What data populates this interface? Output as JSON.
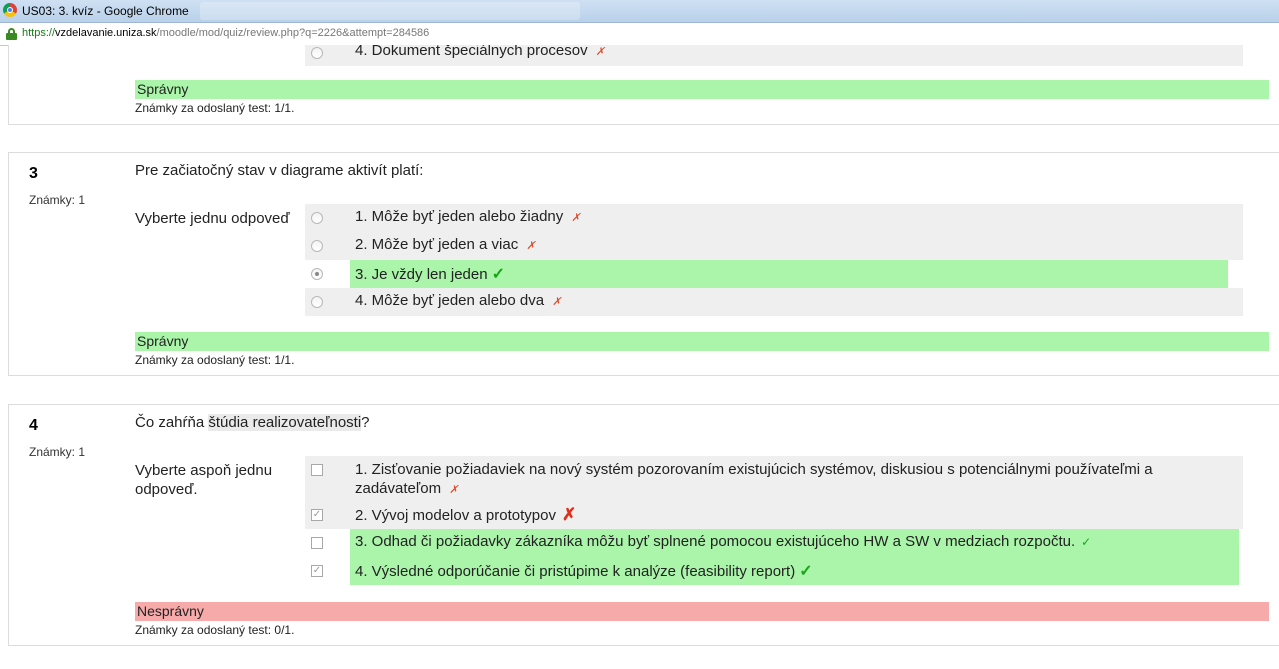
{
  "window": {
    "title": "US03: 3. kvíz - Google Chrome"
  },
  "address": {
    "scheme": "https://",
    "host": "vzdelavanie.uniza.sk",
    "path": "/moodle/mod/quiz/review.php?q=2226&attempt=284586"
  },
  "q2_partial": {
    "answer4": "4. Dokument špeciálnych procesov",
    "state": "Správny",
    "mark": "Známky za odoslaný test: 1/1."
  },
  "q3": {
    "number": "3",
    "grade": "Známky: 1",
    "text": "Pre začiatočný stav v diagrame aktivít platí:",
    "prompt": "Vyberte jednu odpoveď",
    "answers": [
      "1. Môže byť jeden alebo žiadny",
      "2. Môže byť jeden a viac",
      "3. Je vždy len jeden",
      "4. Môže byť jeden alebo dva"
    ],
    "state": "Správny",
    "mark": "Známky za odoslaný test: 1/1."
  },
  "q4": {
    "number": "4",
    "grade": "Známky: 1",
    "text_before": "Čo zahŕňa ",
    "text_highlight": "štúdia realizovateľnosti",
    "text_after": "?",
    "prompt": "Vyberte aspoň jednu odpoveď.",
    "answers": [
      "1. Zisťovanie požiadaviek na nový systém pozorovaním existujúcich systémov, diskusiou s potenciálnymi používateľmi a zadávateľom",
      "2. Vývoj modelov a prototypov",
      "3. Odhad či požiadavky zákazníka môžu byť splnené pomocou existujúceho HW a SW v medziach rozpočtu.",
      "4. Výsledné odporúčanie či pristúpime k analýze (feasibility report)"
    ],
    "state": "Nesprávny",
    "mark": "Známky za odoslaný test: 0/1."
  },
  "icons": {
    "cross": "✗",
    "check": "✓"
  },
  "colors": {
    "correct_bg": "#aaf5aa",
    "incorrect_bg": "#f7aaaa",
    "secure_green": "#1a7a1a"
  }
}
